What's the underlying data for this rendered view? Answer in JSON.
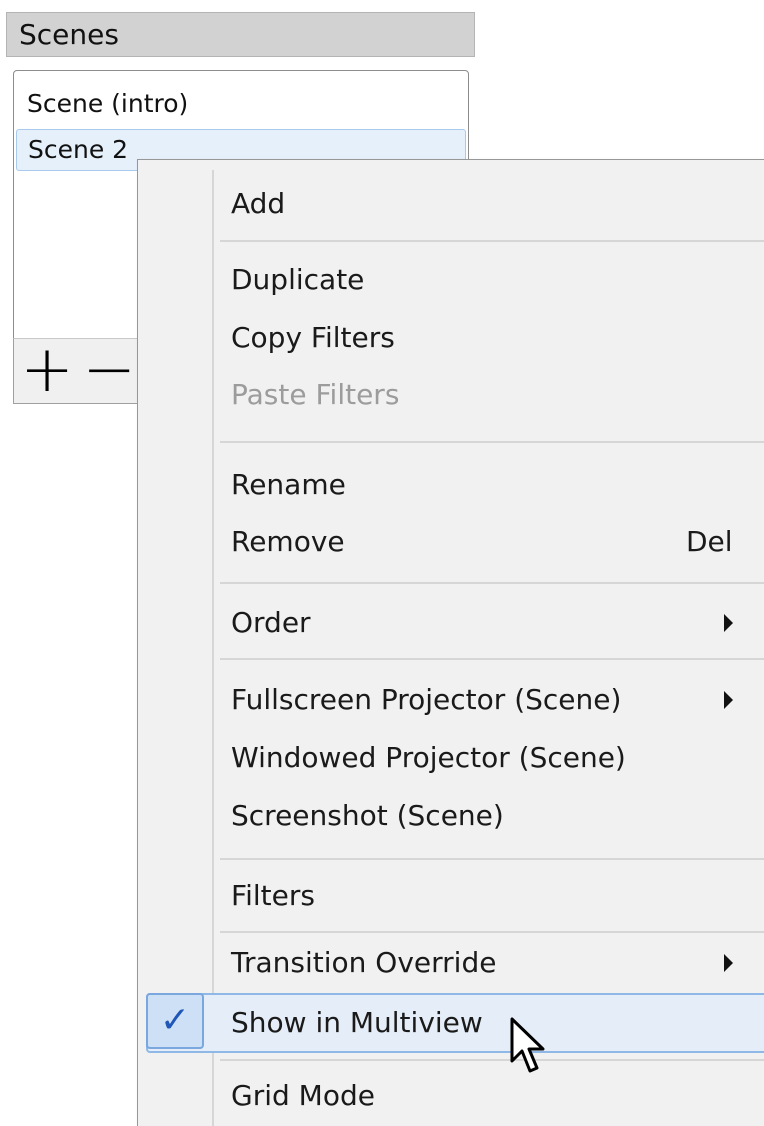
{
  "dock": {
    "title": "Scenes"
  },
  "scene_list": {
    "items": [
      {
        "label": "Scene (intro)",
        "selected": false
      },
      {
        "label": "Scene 2",
        "selected": true
      }
    ]
  },
  "toolbar": {
    "add_label": "+",
    "remove_label": "−",
    "add_icon": "plus-icon",
    "remove_icon": "minus-icon"
  },
  "context_menu": {
    "items": {
      "add": {
        "label": "Add"
      },
      "duplicate": {
        "label": "Duplicate"
      },
      "copy_filters": {
        "label": "Copy Filters"
      },
      "paste_filters": {
        "label": "Paste Filters",
        "enabled": false
      },
      "rename": {
        "label": "Rename"
      },
      "remove": {
        "label": "Remove",
        "shortcut": "Del"
      },
      "order": {
        "label": "Order",
        "submenu": true
      },
      "fullscreen_projector": {
        "label": "Fullscreen Projector (Scene)",
        "submenu": true
      },
      "windowed_projector": {
        "label": "Windowed Projector (Scene)"
      },
      "screenshot": {
        "label": "Screenshot (Scene)"
      },
      "filters": {
        "label": "Filters"
      },
      "transition_override": {
        "label": "Transition Override",
        "submenu": true
      },
      "show_in_multiview": {
        "label": "Show in Multiview",
        "checked": true,
        "check_mark": "✓",
        "hovered": true
      },
      "grid_mode": {
        "label": "Grid Mode"
      }
    },
    "colors": {
      "highlight": "#e5eef8",
      "highlight_border": "#90b8e6",
      "check": "#1f57b7"
    }
  },
  "cursor": {
    "icon": "arrow-cursor-icon"
  }
}
